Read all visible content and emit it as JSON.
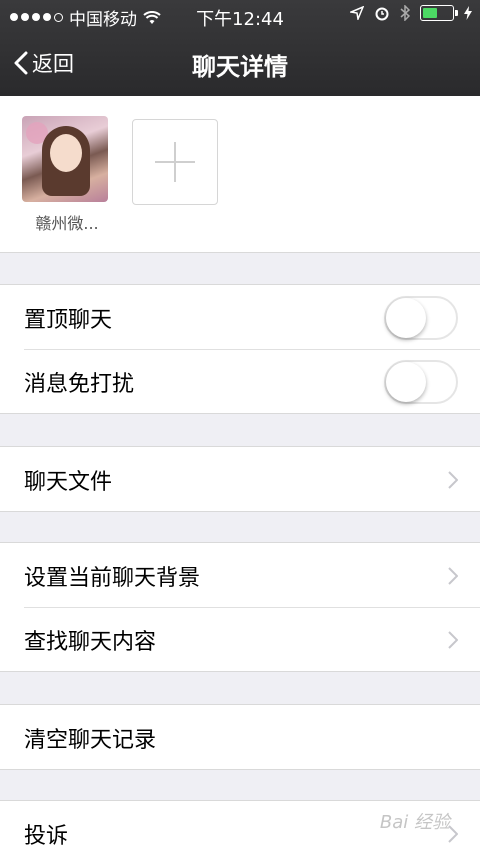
{
  "status_bar": {
    "carrier": "中国移动",
    "time": "下午12:44"
  },
  "nav": {
    "back_label": "返回",
    "title": "聊天详情"
  },
  "members": [
    {
      "name": "赣州微..."
    }
  ],
  "settings": {
    "pin_chat": {
      "label": "置顶聊天",
      "on": false
    },
    "mute": {
      "label": "消息免打扰",
      "on": false
    },
    "chat_files": {
      "label": "聊天文件"
    },
    "set_background": {
      "label": "设置当前聊天背景"
    },
    "search_content": {
      "label": "查找聊天内容"
    },
    "clear_history": {
      "label": "清空聊天记录"
    },
    "report": {
      "label": "投诉"
    }
  },
  "watermark": "Bai 经验",
  "colors": {
    "nav_bg": "#333335",
    "page_bg": "#efeff4",
    "battery_fill": "#4cd964"
  }
}
